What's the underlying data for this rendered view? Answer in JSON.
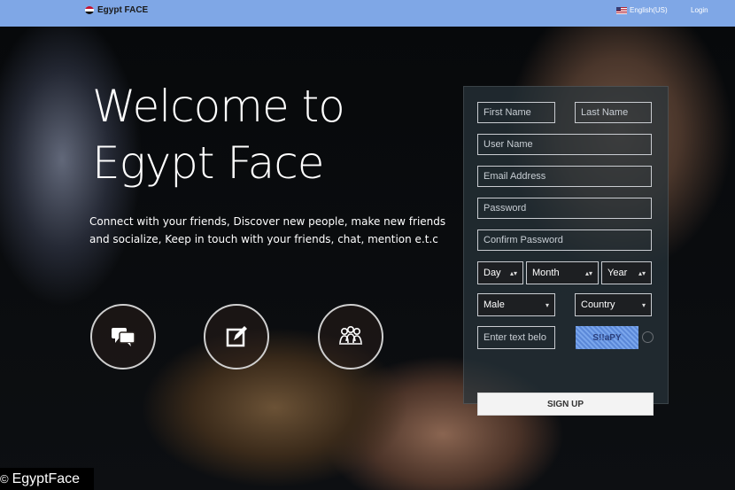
{
  "header": {
    "brand": "Egypt FACE",
    "language": "English(US)",
    "login": "Login"
  },
  "hero": {
    "title_line1": "Welcome to",
    "title_line2": "Egypt Face",
    "tagline_line1": "Connect with your friends, Discover new people, make new friends",
    "tagline_line2": "and socialize, Keep in touch with your friends, chat, mention e.t.c",
    "features": [
      {
        "icon": "chat-bubbles-icon"
      },
      {
        "icon": "edit-note-icon"
      },
      {
        "icon": "people-group-icon"
      }
    ]
  },
  "form": {
    "first_name_placeholder": "First Name",
    "last_name_placeholder": "Last Name",
    "username_placeholder": "User Name",
    "email_placeholder": "Email Address",
    "password_placeholder": "Password",
    "confirm_password_placeholder": "Confirm Password",
    "day": "Day",
    "month": "Month",
    "year": "Year",
    "gender": "Male",
    "country": "Country",
    "captcha_input_placeholder": "Enter text belo",
    "captcha_text": "S!!aPY",
    "signup": "SIGN UP"
  },
  "watermark": "EgyptFace",
  "colors": {
    "topbar": "#7fa7e6",
    "captcha": "#6a96e2"
  }
}
